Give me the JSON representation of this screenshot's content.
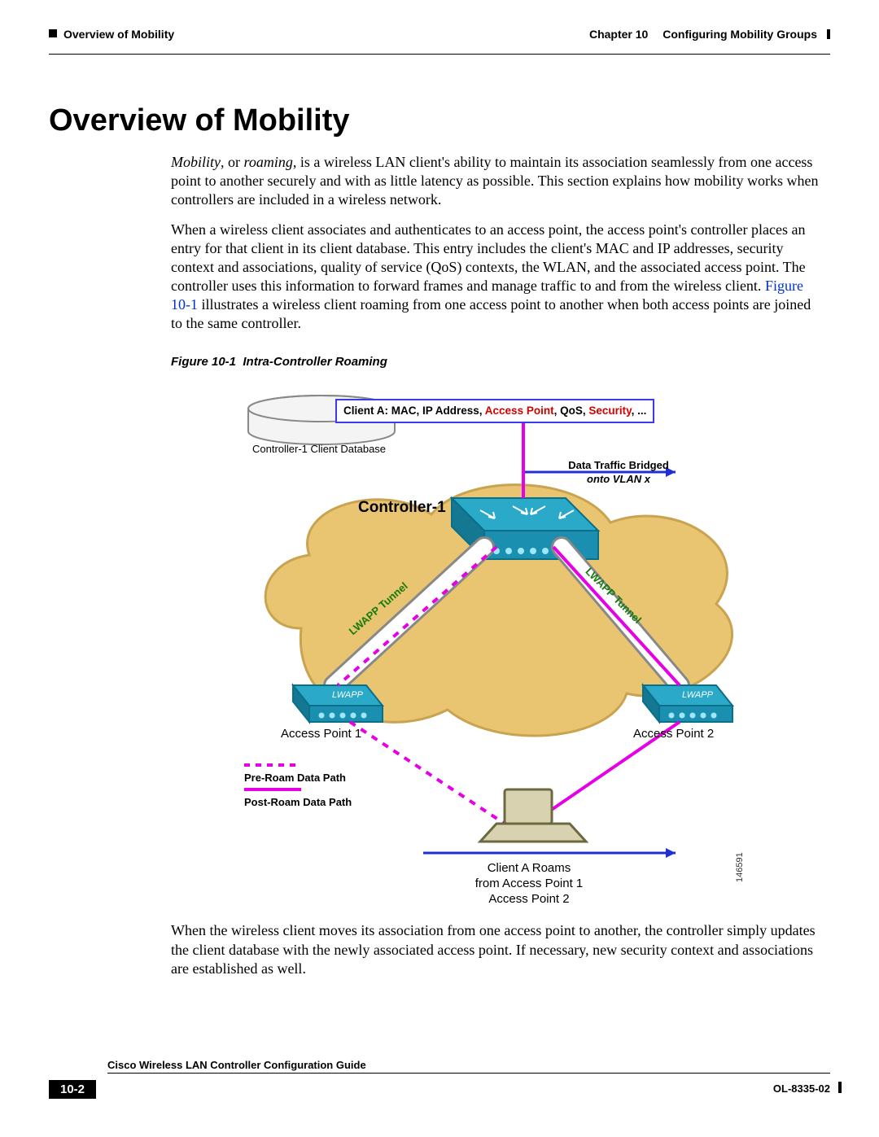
{
  "header": {
    "chapter_label": "Chapter 10",
    "chapter_title": "Configuring Mobility Groups",
    "section_running": "Overview of Mobility"
  },
  "title": "Overview of Mobility",
  "intro": {
    "term1": "Mobility",
    "sep1": ", or ",
    "term2": "roaming",
    "rest": ", is a wireless LAN client's ability to maintain its association seamlessly from one access point to another securely and with as little latency as possible. This section explains how mobility works when controllers are included in a wireless network."
  },
  "para2": {
    "before_link": "When a wireless client associates and authenticates to an access point, the access point's controller places an entry for that client in its client database. This entry includes the client's MAC and IP addresses, security context and associations, quality of service (QoS) contexts, the WLAN, and the associated access point. The controller uses this information to forward frames and manage traffic to and from the wireless client. ",
    "link_text": "Figure 10-1",
    "after_link": " illustrates a wireless client roaming from one access point to another when both access points are joined to the same controller."
  },
  "figure": {
    "caption_num": "Figure 10-1",
    "caption_title": "Intra-Controller Roaming",
    "client_box": {
      "prefix": "Client A: ",
      "fields_plain1": "MAC, IP Address, ",
      "field_red1": "Access Point",
      "fields_plain2": ", QoS, ",
      "field_red2": "Security",
      "suffix": ", ..."
    },
    "db_label": "Controller-1 Client Database",
    "traffic_label_l1": "Data Traffic Bridged",
    "traffic_label_l2": "onto VLAN x",
    "controller_label": "Controller-1",
    "lwapp_left": "LWAPP Tunnel",
    "lwapp_right": "LWAPP Tunnel",
    "ap1": "Access Point 1",
    "ap2": "Access Point 2",
    "legend_pre": "Pre-Roam Data Path",
    "legend_post": "Post-Roam Data Path",
    "roam_l1": "Client A Roams",
    "roam_l2": "from Access Point 1",
    "roam_l3": "Access Point 2",
    "art_id": "146591"
  },
  "para3": "When the wireless client moves its association from one access point to another, the controller simply updates the client database with the newly associated access point. If necessary, new security context and associations are established as well.",
  "footer": {
    "guide": "Cisco Wireless LAN Controller Configuration Guide",
    "page": "10-2",
    "doc": "OL-8335-02"
  }
}
